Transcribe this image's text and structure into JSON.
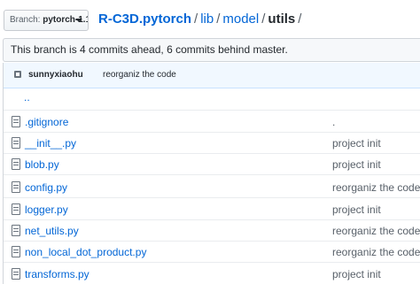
{
  "branch": {
    "prefix": "Branch:",
    "name": "pytorch-1.1"
  },
  "breadcrumb": {
    "repo": "R-C3D.pytorch",
    "parts": [
      "lib",
      "model"
    ],
    "current": "utils",
    "separator": "/"
  },
  "branch_status": "This branch is 4 commits ahead, 6 commits behind master.",
  "latest_commit": {
    "user": "sunnyxiaohu",
    "message": "reorganiz the code"
  },
  "files": [
    {
      "name": "..",
      "message": ""
    },
    {
      "name": ".gitignore",
      "message": "."
    },
    {
      "name": "__init__.py",
      "message": "project init"
    },
    {
      "name": "blob.py",
      "message": "project init"
    },
    {
      "name": "config.py",
      "message": "reorganiz the code"
    },
    {
      "name": "logger.py",
      "message": "project init"
    },
    {
      "name": "net_utils.py",
      "message": "reorganiz the code"
    },
    {
      "name": "non_local_dot_product.py",
      "message": "reorganiz the code"
    },
    {
      "name": "transforms.py",
      "message": "project init"
    }
  ]
}
